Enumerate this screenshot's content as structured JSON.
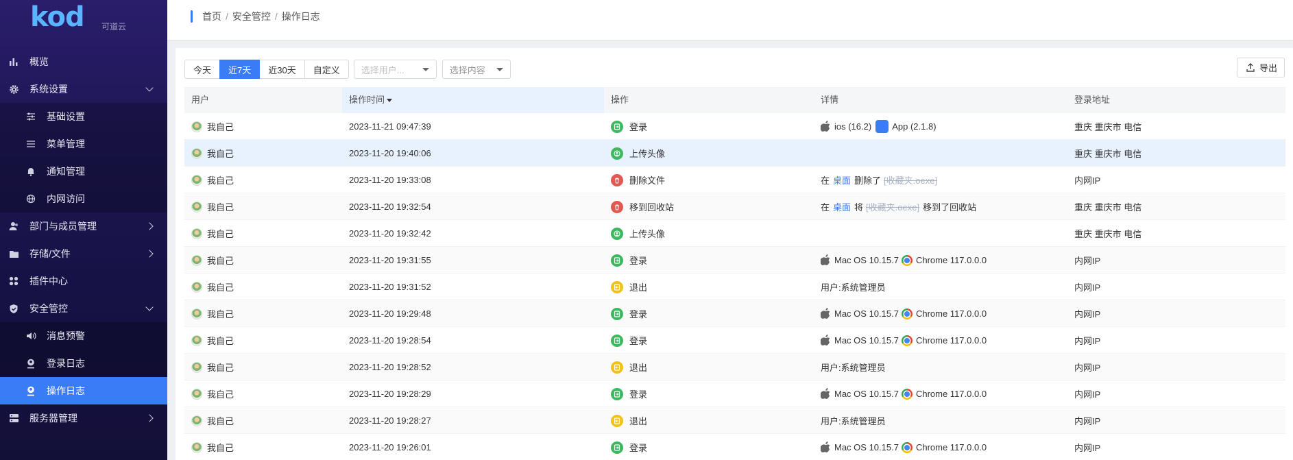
{
  "logo": {
    "text": "kod",
    "sub": "可道云"
  },
  "sidebar": {
    "items": [
      {
        "label": "概览",
        "icon": "bar-chart-icon",
        "level": 1
      },
      {
        "label": "系统设置",
        "icon": "gear-icon",
        "level": 1,
        "arrow": "down"
      },
      {
        "label": "基础设置",
        "icon": "sliders-icon",
        "level": 2
      },
      {
        "label": "菜单管理",
        "icon": "menu-list-icon",
        "level": 2
      },
      {
        "label": "通知管理",
        "icon": "bell-icon",
        "level": 2
      },
      {
        "label": "内网访问",
        "icon": "globe-icon",
        "level": 2
      },
      {
        "label": "部门与成员管理",
        "icon": "users-icon",
        "level": 1,
        "arrow": "right"
      },
      {
        "label": "存储/文件",
        "icon": "folder-icon",
        "level": 1,
        "arrow": "right"
      },
      {
        "label": "插件中心",
        "icon": "apps-icon",
        "level": 1
      },
      {
        "label": "安全管控",
        "icon": "shield-icon",
        "level": 1,
        "arrow": "down"
      },
      {
        "label": "消息预警",
        "icon": "speaker-icon",
        "level": 2
      },
      {
        "label": "登录日志",
        "icon": "user-badge-icon",
        "level": 2
      },
      {
        "label": "操作日志",
        "icon": "user-log-icon",
        "level": 2,
        "active": true
      },
      {
        "label": "服务器管理",
        "icon": "server-icon",
        "level": 1,
        "arrow": "right"
      }
    ]
  },
  "breadcrumb": {
    "items": [
      "首页",
      "安全管控",
      "操作日志"
    ],
    "separator": "/"
  },
  "toolbar": {
    "ranges": [
      "今天",
      "近7天",
      "近30天",
      "自定义"
    ],
    "active_range": "近7天",
    "user_select_placeholder": "选择用户...",
    "content_select_placeholder": "选择内容",
    "export_label": "导出"
  },
  "table": {
    "headers": {
      "user": "用户",
      "time": "操作时间",
      "action": "操作",
      "detail": "详情",
      "addr": "登录地址"
    },
    "rows": [
      {
        "user": "我自己",
        "time": "2023-11-21 09:47:39",
        "action": "登录",
        "action_color": "green",
        "detail_type": "device_app",
        "os": "ios (16.2)",
        "client": "App (2.1.8)",
        "addr": "重庆 重庆市 电信"
      },
      {
        "user": "我自己",
        "time": "2023-11-20 19:40:06",
        "action": "上传头像",
        "action_color": "green",
        "detail_type": "none",
        "addr": "重庆 重庆市 电信",
        "highlight": true
      },
      {
        "user": "我自己",
        "time": "2023-11-20 19:33:08",
        "action": "删除文件",
        "action_color": "red",
        "detail_type": "file",
        "pre": "在",
        "place": "桌面",
        "verb": "删除了",
        "file": "[收藏夹.oexe]",
        "post": "",
        "addr": "内网IP"
      },
      {
        "user": "我自己",
        "time": "2023-11-20 19:32:54",
        "action": "移到回收站",
        "action_color": "red",
        "detail_type": "file",
        "pre": "在",
        "place": "桌面",
        "verb": "将",
        "file": "[收藏夹.oexe]",
        "post": "移到了回收站",
        "addr": "重庆 重庆市 电信"
      },
      {
        "user": "我自己",
        "time": "2023-11-20 19:32:42",
        "action": "上传头像",
        "action_color": "green",
        "detail_type": "none",
        "addr": "重庆 重庆市 电信"
      },
      {
        "user": "我自己",
        "time": "2023-11-20 19:31:55",
        "action": "登录",
        "action_color": "green",
        "detail_type": "device_browser",
        "os": "Mac OS 10.15.7",
        "client": "Chrome 117.0.0.0",
        "addr": "内网IP"
      },
      {
        "user": "我自己",
        "time": "2023-11-20 19:31:52",
        "action": "退出",
        "action_color": "yellow",
        "detail_type": "text",
        "text": "用户:系统管理员",
        "addr": "内网IP"
      },
      {
        "user": "我自己",
        "time": "2023-11-20 19:29:48",
        "action": "登录",
        "action_color": "green",
        "detail_type": "device_browser",
        "os": "Mac OS 10.15.7",
        "client": "Chrome 117.0.0.0",
        "addr": "内网IP"
      },
      {
        "user": "我自己",
        "time": "2023-11-20 19:28:54",
        "action": "登录",
        "action_color": "green",
        "detail_type": "device_browser",
        "os": "Mac OS 10.15.7",
        "client": "Chrome 117.0.0.0",
        "addr": "内网IP"
      },
      {
        "user": "我自己",
        "time": "2023-11-20 19:28:52",
        "action": "退出",
        "action_color": "yellow",
        "detail_type": "text",
        "text": "用户:系统管理员",
        "addr": "内网IP"
      },
      {
        "user": "我自己",
        "time": "2023-11-20 19:28:29",
        "action": "登录",
        "action_color": "green",
        "detail_type": "device_browser",
        "os": "Mac OS 10.15.7",
        "client": "Chrome 117.0.0.0",
        "addr": "内网IP"
      },
      {
        "user": "我自己",
        "time": "2023-11-20 19:28:27",
        "action": "退出",
        "action_color": "yellow",
        "detail_type": "text",
        "text": "用户:系统管理员",
        "addr": "内网IP"
      },
      {
        "user": "我自己",
        "time": "2023-11-20 19:26:01",
        "action": "登录",
        "action_color": "green",
        "detail_type": "device_browser",
        "os": "Mac OS 10.15.7",
        "client": "Chrome 117.0.0.0",
        "addr": "内网IP"
      }
    ]
  },
  "colors": {
    "accent": "#3a7bf6",
    "green": "#3db861",
    "red": "#e05a52",
    "yellow": "#f2c21b"
  }
}
